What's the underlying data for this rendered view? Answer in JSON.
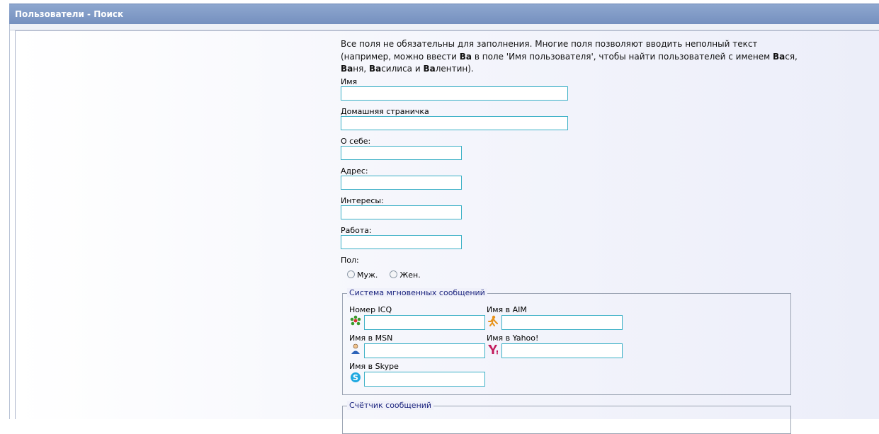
{
  "window": {
    "title": "Пользователи - Поиск"
  },
  "intro": {
    "segments": [
      {
        "t": "Все поля не обязательны для заполнения. Многие поля позволяют вводить неполный текст (например, можно ввести ",
        "b": false
      },
      {
        "t": "Ва",
        "b": true
      },
      {
        "t": " в поле 'Имя пользователя', чтобы найти пользователей с именем ",
        "b": false
      },
      {
        "t": "Ва",
        "b": true
      },
      {
        "t": "ся, ",
        "b": false
      },
      {
        "t": "Ва",
        "b": true
      },
      {
        "t": "ня, ",
        "b": false
      },
      {
        "t": "Ва",
        "b": true
      },
      {
        "t": "силиса и ",
        "b": false
      },
      {
        "t": "Ва",
        "b": true
      },
      {
        "t": "лентин).",
        "b": false
      }
    ]
  },
  "fields": {
    "name": {
      "label": "Имя",
      "value": ""
    },
    "homepage": {
      "label": "Домашняя страничка",
      "value": ""
    },
    "about": {
      "label": "О себе:",
      "value": ""
    },
    "address": {
      "label": "Адрес:",
      "value": ""
    },
    "interests": {
      "label": "Интересы:",
      "value": ""
    },
    "work": {
      "label": "Работа:",
      "value": ""
    }
  },
  "gender": {
    "label": "Пол:",
    "male": "Муж.",
    "female": "Жен."
  },
  "im": {
    "legend": "Система мгновенных сообщений",
    "icq": {
      "label": "Номер ICQ",
      "icon": "icq-icon",
      "value": ""
    },
    "aim": {
      "label": "Имя в AIM",
      "icon": "aim-icon",
      "value": ""
    },
    "msn": {
      "label": "Имя в MSN",
      "icon": "msn-icon",
      "value": ""
    },
    "yahoo": {
      "label": "Имя в Yahoo!",
      "icon": "yahoo-icon",
      "value": ""
    },
    "skype": {
      "label": "Имя в Skype",
      "icon": "skype-icon",
      "value": ""
    }
  },
  "posts": {
    "legend": "Счётчик сообщений"
  },
  "colors": {
    "title_bar": "#7f99c6",
    "input_border": "#3bb0c6",
    "legend_text": "#1a237e"
  }
}
